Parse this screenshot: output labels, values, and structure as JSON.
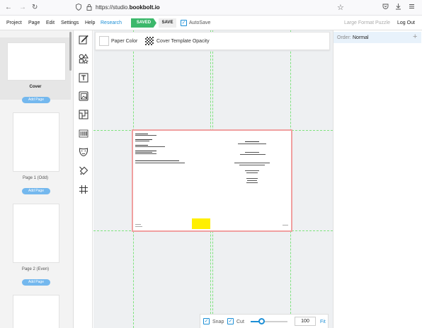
{
  "browser": {
    "url_prefix": "https://studio.",
    "url_domain": "bookbolt.io",
    "icons": [
      "back-arrow-icon",
      "forward-arrow-icon",
      "reload-icon",
      "shield-icon",
      "lock-icon",
      "bookmark-star-icon",
      "pocket-icon",
      "download-icon",
      "hamburger-menu-icon"
    ]
  },
  "menu": {
    "items": [
      "Project",
      "Page",
      "Edit",
      "Settings",
      "Help",
      "Research"
    ],
    "saved_label": "SAVED",
    "save_label": "SAVE",
    "autosave_label": "AutoSave",
    "autosave_checked": true,
    "large_format": "Large Format Puzzle",
    "logout": "Log Out"
  },
  "thumbnails": {
    "items": [
      {
        "label": "Cover",
        "selected": true
      },
      {
        "label": "Page 1 (Odd)",
        "selected": false
      },
      {
        "label": "Page 2 (Even)",
        "selected": false
      }
    ],
    "add_page_label": "Add Page"
  },
  "tools": {
    "icons": [
      "pencil-edit-icon",
      "shapes-icon",
      "text-box-icon",
      "image-icon",
      "puzzle-icon",
      "barcode-icon",
      "mask-icon",
      "paint-bucket-icon",
      "grid-icon"
    ]
  },
  "toolbar": {
    "paper_color_label": "Paper Color",
    "opacity_label": "Cover Template Opacity"
  },
  "zoom": {
    "snap_label": "Snap",
    "cut_label": "Cut",
    "snap_checked": true,
    "cut_checked": true,
    "value": "100",
    "fit_label": "Fit",
    "slider_fraction": 0.28
  },
  "right_panel": {
    "order_label": "Order:",
    "order_value": "Normal"
  },
  "colors": {
    "accent": "#1d8fd6",
    "saved_green": "#3cb86b",
    "guide_green": "#7fe37f",
    "spread_border": "#f0a0a0",
    "highlight_yellow": "#ffef00"
  }
}
